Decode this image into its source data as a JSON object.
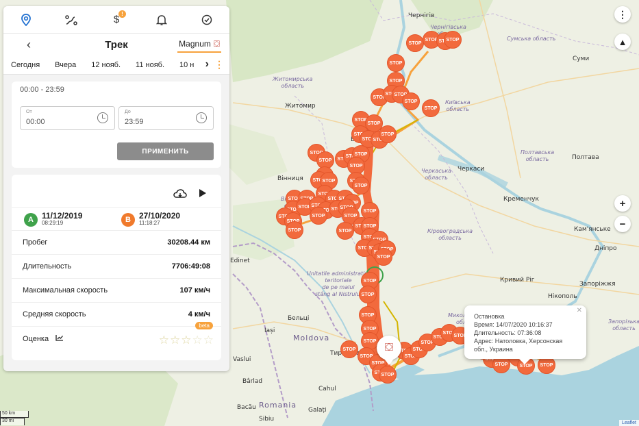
{
  "nav": {
    "icons": [
      "map-pin-icon",
      "route-icon",
      "dollar-icon",
      "bell-icon",
      "checkbox-icon"
    ],
    "dollar_badge": "!"
  },
  "header": {
    "title": "Трек",
    "vehicle": "Magnum"
  },
  "dates": {
    "tabs": [
      "Сегодня",
      "Вчера",
      "12 нояб.",
      "11 нояб.",
      "10 н"
    ]
  },
  "time_filter": {
    "range": "00:00 - 23:59",
    "from_label": "От",
    "from_value": "00:00",
    "to_label": "До",
    "to_value": "23:59",
    "apply_label": "ПРИМЕНИТЬ"
  },
  "trip": {
    "start_badge": "A",
    "start_date": "11/12/2019",
    "start_time": "08:29:19",
    "end_badge": "B",
    "end_date": "27/10/2020",
    "end_time": "11:18:27",
    "stats": [
      {
        "label": "Пробег",
        "value": "30208.44 км"
      },
      {
        "label": "Длительность",
        "value": "7706:49:08"
      },
      {
        "label": "Максимальная скорость",
        "value": "107 км/ч"
      },
      {
        "label": "Средняя скорость",
        "value": "4 км/ч"
      }
    ],
    "rating_label": "Оценка",
    "rating_value": 0,
    "rating_max": 5,
    "beta": "beta"
  },
  "popup": {
    "title": "Остановка",
    "time": "Время: 14/07/2020 10:16:37",
    "duration": "Длительность: 07:36:08",
    "address": "Адрес: Натоловка, Херсонская обл., Украина"
  },
  "map": {
    "colors": {
      "route": "#f26a3d",
      "stop": "#f26a3d",
      "track": "#f7a23c",
      "accent": "#f7a23c"
    },
    "stop_label": "STOP",
    "labels": [
      {
        "text": "Чернігів",
        "kind": "city"
      },
      {
        "text": "Чернігівська\nобласть",
        "kind": "region"
      },
      {
        "text": "Сумська область",
        "kind": "region"
      },
      {
        "text": "Суми",
        "kind": "city"
      },
      {
        "text": "Житомирська\nобласть",
        "kind": "region"
      },
      {
        "text": "Житомир",
        "kind": "city"
      },
      {
        "text": "Київська\nобласть",
        "kind": "region"
      },
      {
        "text": "Біла",
        "kind": "city"
      },
      {
        "text": "Полтавська\nобласть",
        "kind": "region"
      },
      {
        "text": "Полтава",
        "kind": "city"
      },
      {
        "text": "Черкаська\nобласть",
        "kind": "region"
      },
      {
        "text": "Черкаси",
        "kind": "city"
      },
      {
        "text": "Вінниця",
        "kind": "city"
      },
      {
        "text": "Вінницька\nобласть",
        "kind": "region"
      },
      {
        "text": "Кременчук",
        "kind": "city"
      },
      {
        "text": "Кіровоградська\nобласть",
        "kind": "region"
      },
      {
        "text": "Кам'янське",
        "kind": "city"
      },
      {
        "text": "Дніпро",
        "kind": "city"
      },
      {
        "text": "Edinet",
        "kind": "city"
      },
      {
        "text": "Кривий Ріг",
        "kind": "city"
      },
      {
        "text": "Запоріжжя",
        "kind": "city"
      },
      {
        "text": "Unitatile administrativ-\nteritoriale\nde pe malul\nstâng al Nistrului",
        "kind": "region"
      },
      {
        "text": "Миколаївська\nобласть",
        "kind": "region"
      },
      {
        "text": "Нікополь",
        "kind": "city"
      },
      {
        "text": "Запорізька\nобласть",
        "kind": "region"
      },
      {
        "text": "Бельці",
        "kind": "city"
      },
      {
        "text": "Iași",
        "kind": "city"
      },
      {
        "text": "Moldova",
        "kind": "country"
      },
      {
        "text": "Тирасполь",
        "kind": "city"
      },
      {
        "text": "Vaslui",
        "kind": "city"
      },
      {
        "text": "Bârlad",
        "kind": "city"
      },
      {
        "text": "Cahul",
        "kind": "city"
      },
      {
        "text": "Romania",
        "kind": "country"
      },
      {
        "text": "Galați",
        "kind": "city"
      },
      {
        "text": "Bacău",
        "kind": "city"
      },
      {
        "text": "Sibiu",
        "kind": "city"
      }
    ],
    "scale_km": "50 km",
    "scale_mi": "30 mi",
    "attribution": "Leaflet"
  }
}
